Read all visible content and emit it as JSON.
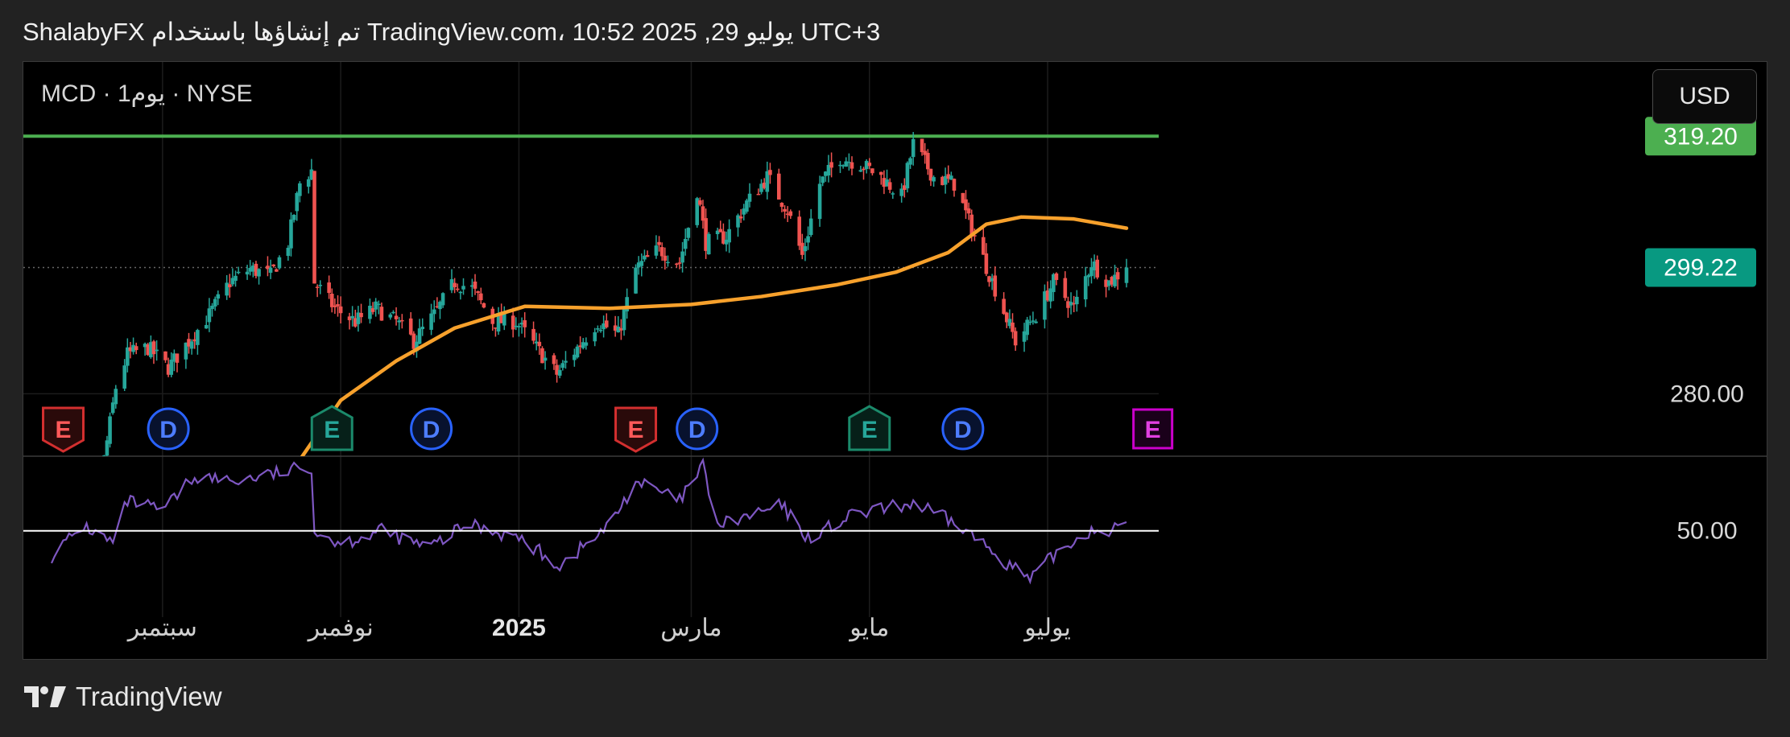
{
  "header": {
    "title": "ShalabyFX تم إنشاؤها باستخدام TradingView.com، 10:52 2025 ,29 يوليو UTC+3"
  },
  "chart": {
    "symbol_label": "MCD · 1يوم · NYSE",
    "currency_button": "USD",
    "footer_brand": "TradingView",
    "brand_icon": "tradingview-logo-icon"
  },
  "colors": {
    "background": "#000000",
    "page": "#222222",
    "candle_up": "#26a69a",
    "candle_down": "#ef5350",
    "ma": "#f7a12c",
    "resistance": "#4caf50",
    "last_price": "#089981",
    "rsi": "#7e57c2",
    "earnings_past": "#d32f2f",
    "earnings_beat": "#1b8a6b",
    "dividend": "#2962ff",
    "earnings_future": "#cc00cc"
  },
  "chart_data": [
    {
      "type": "candlestick",
      "ylim": [
        270.5,
        330.5
      ],
      "y_ticks": [
        280.0
      ],
      "price_labels": {
        "resistance": "319.20",
        "last": "299.22"
      },
      "resistance_level": 319.2,
      "last_price": 299.22,
      "x_ticks": [
        {
          "label": "سبتمبر",
          "date": "2024-09-01"
        },
        {
          "label": "نوفمبر",
          "date": "2024-11-01"
        },
        {
          "label": "2025",
          "date": "2025-01-01",
          "bold": true
        },
        {
          "label": "مارس",
          "date": "2025-03-01"
        },
        {
          "label": "مايو",
          "date": "2025-05-01"
        },
        {
          "label": "يوليو",
          "date": "2025-07-01"
        }
      ],
      "date_range": [
        "2024-07-25",
        "2025-07-28"
      ],
      "close_path": [
        [
          "2024-07-29",
          258
        ],
        [
          "2024-08-05",
          262
        ],
        [
          "2024-08-12",
          270
        ],
        [
          "2024-08-16",
          281
        ],
        [
          "2024-08-20",
          286
        ],
        [
          "2024-08-27",
          287
        ],
        [
          "2024-09-03",
          284
        ],
        [
          "2024-09-10",
          288
        ],
        [
          "2024-09-17",
          292
        ],
        [
          "2024-09-24",
          297
        ],
        [
          "2024-10-01",
          299
        ],
        [
          "2024-10-08",
          298
        ],
        [
          "2024-10-14",
          303
        ],
        [
          "2024-10-18",
          312
        ],
        [
          "2024-10-22",
          314
        ],
        [
          "2024-10-23",
          297
        ],
        [
          "2024-10-30",
          293
        ],
        [
          "2024-11-06",
          291
        ],
        [
          "2024-11-13",
          293
        ],
        [
          "2024-11-20",
          291
        ],
        [
          "2024-11-26",
          288
        ],
        [
          "2024-12-03",
          292
        ],
        [
          "2024-12-10",
          297
        ],
        [
          "2024-12-16",
          296
        ],
        [
          "2024-12-23",
          291
        ],
        [
          "2024-12-31",
          291
        ],
        [
          "2025-01-07",
          287
        ],
        [
          "2025-01-14",
          283
        ],
        [
          "2025-01-21",
          287
        ],
        [
          "2025-01-28",
          291
        ],
        [
          "2025-02-04",
          289
        ],
        [
          "2025-02-10",
          299
        ],
        [
          "2025-02-18",
          302
        ],
        [
          "2025-02-25",
          300
        ],
        [
          "2025-03-03",
          311
        ],
        [
          "2025-03-06",
          303
        ],
        [
          "2025-03-13",
          304
        ],
        [
          "2025-03-20",
          309
        ],
        [
          "2025-03-27",
          313
        ],
        [
          "2025-04-03",
          308
        ],
        [
          "2025-04-08",
          301
        ],
        [
          "2025-04-14",
          312
        ],
        [
          "2025-04-21",
          316
        ],
        [
          "2025-04-28",
          315
        ],
        [
          "2025-05-05",
          313
        ],
        [
          "2025-05-12",
          310
        ],
        [
          "2025-05-16",
          318
        ],
        [
          "2025-05-23",
          313
        ],
        [
          "2025-05-30",
          312
        ],
        [
          "2025-06-06",
          304
        ],
        [
          "2025-06-13",
          296
        ],
        [
          "2025-06-20",
          288
        ],
        [
          "2025-06-27",
          292
        ],
        [
          "2025-07-03",
          297
        ],
        [
          "2025-07-10",
          293
        ],
        [
          "2025-07-16",
          300
        ],
        [
          "2025-07-22",
          297
        ],
        [
          "2025-07-28",
          299.22
        ]
      ],
      "ma_path": [
        [
          "2024-10-01",
          260
        ],
        [
          "2024-10-15",
          268
        ],
        [
          "2024-11-01",
          279
        ],
        [
          "2024-11-20",
          285
        ],
        [
          "2024-12-10",
          290
        ],
        [
          "2025-01-03",
          293.3
        ],
        [
          "2025-02-01",
          293
        ],
        [
          "2025-03-01",
          293.6
        ],
        [
          "2025-03-25",
          294.8
        ],
        [
          "2025-04-20",
          296.6
        ],
        [
          "2025-05-10",
          298.5
        ],
        [
          "2025-05-28",
          301.5
        ],
        [
          "2025-06-10",
          305.8
        ],
        [
          "2025-06-22",
          306.9
        ],
        [
          "2025-07-10",
          306.6
        ],
        [
          "2025-07-28",
          305.2
        ]
      ],
      "events": [
        {
          "label": "E",
          "kind": "earnings",
          "status": "miss",
          "date": "2024-07-29"
        },
        {
          "label": "D",
          "kind": "dividend",
          "date": "2024-09-03"
        },
        {
          "label": "E",
          "kind": "earnings",
          "status": "beat",
          "date": "2024-10-29"
        },
        {
          "label": "D",
          "kind": "dividend",
          "date": "2024-12-02"
        },
        {
          "label": "E",
          "kind": "earnings",
          "status": "miss",
          "date": "2025-02-10"
        },
        {
          "label": "D",
          "kind": "dividend",
          "date": "2025-03-03"
        },
        {
          "label": "E",
          "kind": "earnings",
          "status": "beat",
          "date": "2025-05-01"
        },
        {
          "label": "D",
          "kind": "dividend",
          "date": "2025-06-02"
        },
        {
          "label": "E",
          "kind": "earnings",
          "status": "upcoming",
          "date": "2025-08-06"
        }
      ]
    },
    {
      "type": "line",
      "series": [
        {
          "values_path": [
            [
              "2024-07-25",
              40
            ],
            [
              "2024-08-05",
              52
            ],
            [
              "2024-08-15",
              45
            ],
            [
              "2024-08-20",
              62
            ],
            [
              "2024-09-01",
              58
            ],
            [
              "2024-09-12",
              72
            ],
            [
              "2024-09-25",
              70
            ],
            [
              "2024-10-10",
              73
            ],
            [
              "2024-10-22",
              76
            ],
            [
              "2024-10-23",
              50
            ],
            [
              "2024-11-01",
              45
            ],
            [
              "2024-11-15",
              50
            ],
            [
              "2024-12-01",
              43
            ],
            [
              "2024-12-15",
              53
            ],
            [
              "2025-01-01",
              47
            ],
            [
              "2025-01-15",
              36
            ],
            [
              "2025-02-01",
              52
            ],
            [
              "2025-02-10",
              70
            ],
            [
              "2025-02-25",
              62
            ],
            [
              "2025-03-05",
              76
            ],
            [
              "2025-03-10",
              52
            ],
            [
              "2025-04-01",
              60
            ],
            [
              "2025-04-10",
              47
            ],
            [
              "2025-04-25",
              56
            ],
            [
              "2025-05-16",
              61
            ],
            [
              "2025-06-01",
              52
            ],
            [
              "2025-06-25",
              30
            ],
            [
              "2025-07-03",
              40
            ],
            [
              "2025-07-15",
              50
            ],
            [
              "2025-07-28",
              51
            ]
          ]
        }
      ],
      "reference_line": 50.0,
      "reference_label": "50.00",
      "ylim": [
        25,
        80
      ]
    }
  ]
}
